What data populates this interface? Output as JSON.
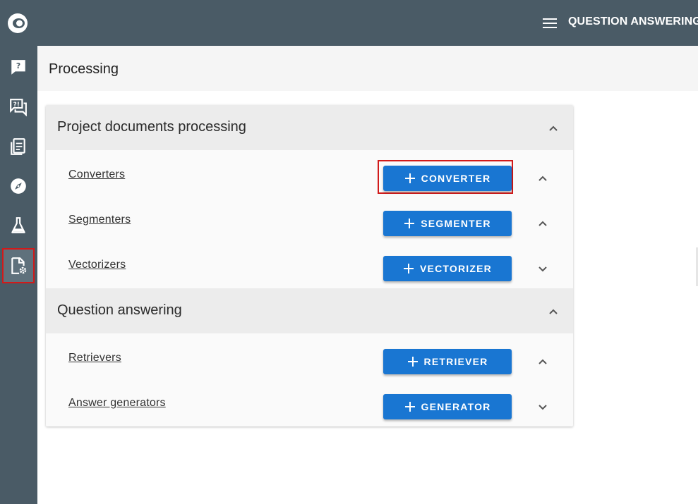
{
  "header": {
    "app_title": "QUESTION ANSWERING C",
    "page_title": "Processing"
  },
  "sidebar": {
    "items": [
      {
        "name": "question-bubble-icon",
        "active": false
      },
      {
        "name": "qa-chat-icon",
        "active": false
      },
      {
        "name": "documents-icon",
        "active": false
      },
      {
        "name": "compass-icon",
        "active": false
      },
      {
        "name": "flask-icon",
        "active": false
      },
      {
        "name": "document-settings-icon",
        "active": true
      }
    ]
  },
  "sections": [
    {
      "title": "Project documents processing",
      "rows": [
        {
          "label": "Converters",
          "button": "CONVERTER",
          "expanded": true,
          "highlighted": true
        },
        {
          "label": "Segmenters",
          "button": "SEGMENTER",
          "expanded": true
        },
        {
          "label": "Vectorizers",
          "button": "VECTORIZER",
          "expanded": false
        }
      ]
    },
    {
      "title": "Question answering",
      "rows": [
        {
          "label": "Retrievers",
          "button": "RETRIEVER",
          "expanded": true
        },
        {
          "label": "Answer generators",
          "button": "GENERATOR",
          "expanded": false
        }
      ]
    }
  ],
  "colors": {
    "sidebar": "#4a5b66",
    "primary_button": "#1976d2",
    "highlight": "#d11a1a"
  }
}
